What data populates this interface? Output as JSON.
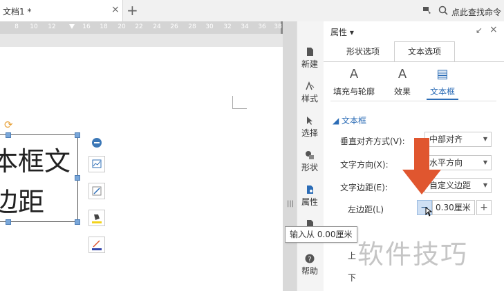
{
  "window": {
    "doc_tab_title": "文档1 *",
    "doc_tab_close": "×",
    "new_tab": "+",
    "command_search_label": "点此查找命令"
  },
  "ruler": {
    "numbers": [
      "8",
      "10",
      "12",
      "16",
      "18",
      "20",
      "22",
      "24",
      "26",
      "28",
      "30",
      "32",
      "34",
      "36",
      "38"
    ]
  },
  "textbox": {
    "line1": "本框文",
    "line2": "边距"
  },
  "rail": {
    "items": [
      {
        "label": "新建",
        "icon": "new-doc-icon"
      },
      {
        "label": "样式",
        "icon": "style-icon"
      },
      {
        "label": "选择",
        "icon": "select-icon"
      },
      {
        "label": "形状",
        "icon": "shape-icon"
      },
      {
        "label": "属性",
        "icon": "property-icon"
      },
      {
        "label": "帮助",
        "icon": "help-icon"
      }
    ]
  },
  "panel": {
    "title": "属性 ▾",
    "pin": "↙",
    "close": "×",
    "tabs": [
      "形状选项",
      "文本选项"
    ],
    "active_tab": "文本选项",
    "subtabs": [
      {
        "label": "填充与轮廓",
        "icon": "A"
      },
      {
        "label": "效果",
        "icon": "A"
      },
      {
        "label": "文本框",
        "icon": "▤"
      }
    ],
    "active_subtab": "文本框",
    "section_title": "文本框",
    "fields": {
      "valign_label": "垂直对齐方式(V):",
      "valign_value": "中部对齐",
      "direction_label": "文字方向(X):",
      "direction_value": "水平方向",
      "margin_label": "文字边距(E):",
      "margin_value": "自定义边距",
      "left_margin_label": "左边距(L)",
      "left_margin_value": "0.30厘米",
      "stepper_minus": "−",
      "stepper_plus": "+",
      "partial_label_1": "上",
      "partial_label_2": "下"
    }
  },
  "tooltip": "输入从 0.00厘米",
  "watermark": "软件技巧",
  "colors": {
    "accent": "#2b6cb6",
    "arrow": "#e0562f",
    "handle": "#7aa7d9"
  }
}
